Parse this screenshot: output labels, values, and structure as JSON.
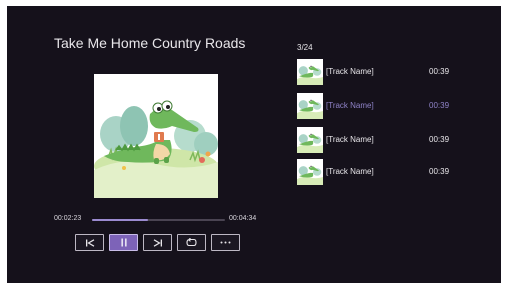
{
  "player": {
    "song_title": "Take Me Home Country Roads",
    "elapsed": "00:02:23",
    "total": "00:04:34",
    "progress": 0.42,
    "cover_icon": "crocodile-illustration"
  },
  "controls": {
    "buttons": [
      {
        "name": "previous-icon",
        "state": "normal"
      },
      {
        "name": "pause-icon",
        "state": "active"
      },
      {
        "name": "next-icon",
        "state": "normal"
      },
      {
        "name": "repeat-icon",
        "state": "normal"
      },
      {
        "name": "more-icon",
        "label": "···",
        "state": "normal"
      }
    ]
  },
  "playlist": {
    "counter": "3/24",
    "items": [
      {
        "name": "[Track Name]",
        "duration": "00:39",
        "current": false
      },
      {
        "name": "[Track Name]",
        "duration": "00:39",
        "current": true
      },
      {
        "name": "[Track Name]",
        "duration": "00:39",
        "current": false
      },
      {
        "name": "[Track Name]",
        "duration": "00:39",
        "current": false
      }
    ]
  },
  "colors": {
    "background": "#15111b",
    "accent": "#7d63b8",
    "highlight_text": "#8f83c8",
    "text": "#e8e6ea"
  }
}
